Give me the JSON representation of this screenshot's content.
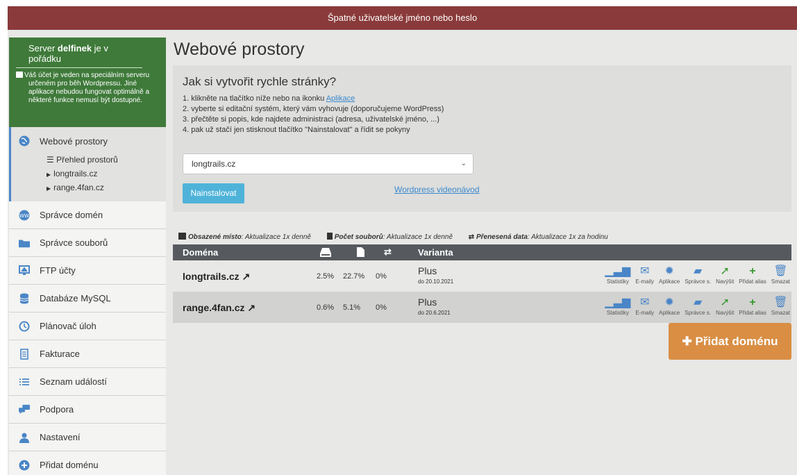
{
  "alert": "Špatné uživatelské jméno nebo heslo",
  "server": {
    "prefix": "Server",
    "name": "delfinek",
    "suffix": "je v pořádku",
    "desc": "Váš účet je veden na speciálním serveru určeném pro běh Wordpressu. Jiné aplikace nebudou fungovat optimálně a některé funkce nemusí být dostupné."
  },
  "nav": {
    "active": {
      "label": "Webové prostory",
      "sub": [
        "Přehled prostorů",
        "longtrails.cz",
        "range.4fan.cz"
      ]
    },
    "items": [
      {
        "label": "Správce domén",
        "icon": "domain-icon"
      },
      {
        "label": "Správce souborů",
        "icon": "folder-icon"
      },
      {
        "label": "FTP účty",
        "icon": "ftp-icon"
      },
      {
        "label": "Databáze MySQL",
        "icon": "database-icon"
      },
      {
        "label": "Plánovač úloh",
        "icon": "clock-icon"
      },
      {
        "label": "Fakturace",
        "icon": "invoice-icon"
      },
      {
        "label": "Seznam událostí",
        "icon": "list-icon"
      },
      {
        "label": "Podpora",
        "icon": "chat-icon"
      },
      {
        "label": "Nastavení",
        "icon": "user-icon"
      },
      {
        "label": "Přidat doménu",
        "icon": "plus-circle-icon"
      }
    ]
  },
  "main": {
    "title": "Webové prostory",
    "howto": {
      "title": "Jak si vytvořit rychle stránky?",
      "step1_pre": "1. klikněte na tlačítko níže nebo na ikonku",
      "step1_link": "Aplikace",
      "step2": "2. vyberte si editační systém, který vám vyhovuje (doporučujeme WordPress)",
      "step3": "3. přečtěte si popis, kde najdete administraci (adresa, uživatelské jméno, ...)",
      "step4": "4. pak už stačí jen stisknout tlačítko \"Nainstalovat\" a řídit se pokyny",
      "select_value": "longtrails.cz",
      "install_button": "Nainstalovat",
      "video_link": "Wordpress videonávod"
    },
    "legend": {
      "space": "Obsazené místo",
      "space_note": ": Aktualizace 1x denně",
      "files": "Počet souborů",
      "files_note": ": Aktualizace 1x denně",
      "transfer": "Přenesená data",
      "transfer_note": ": Aktualizace 1x za hodinu"
    },
    "table": {
      "col_domain": "Doména",
      "col_variant": "Varianta",
      "rows": [
        {
          "domain": "longtrails.cz",
          "space": "2.5%",
          "files": "22.7%",
          "transfer": "0%",
          "variant": "Plus",
          "until": "do 20.10.2021"
        },
        {
          "domain": "range.4fan.cz",
          "space": "0.6%",
          "files": "5.1%",
          "transfer": "0%",
          "variant": "Plus",
          "until": "do 20.6.2021"
        }
      ],
      "actions": [
        "Statistiky",
        "E-maily",
        "Aplikace",
        "Správce s.",
        "Navýšit",
        "Přidat alias",
        "Smazat"
      ]
    },
    "add_domain_button": "Přidat doménu"
  }
}
